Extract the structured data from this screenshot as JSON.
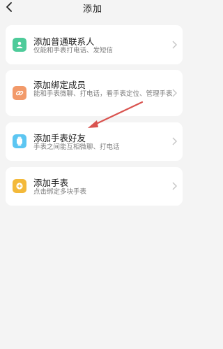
{
  "header": {
    "title": "添加"
  },
  "items": [
    {
      "title": "添加普通联系人",
      "subtitle": "仅能和手表打电话、发短信",
      "icon": "person-icon",
      "color": "#4ecb9a"
    },
    {
      "title": "添加绑定成员",
      "subtitle": "能和手表微聊、打电话，看手表定位、管理手表",
      "icon": "link-icon",
      "color": "#f29a6a"
    },
    {
      "title": "添加手表好友",
      "subtitle": "手表之间能互相微聊、打电话",
      "icon": "watch-icon",
      "color": "#5cc6f2"
    },
    {
      "title": "添加手表",
      "subtitle": "点击绑定多块手表",
      "icon": "plus-circle-icon",
      "color": "#f3b93a"
    }
  ],
  "annotation": {
    "color": "#d9534f",
    "icon": "red-arrow-icon"
  }
}
